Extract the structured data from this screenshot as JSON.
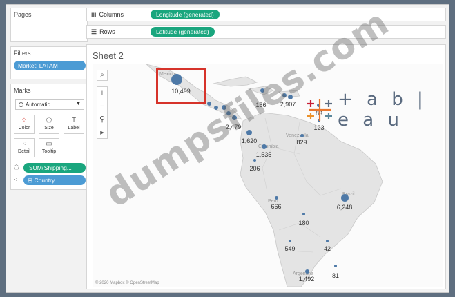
{
  "pages": {
    "title": "Pages"
  },
  "filters": {
    "title": "Filters",
    "pill": "Market: LATAM"
  },
  "marks": {
    "title": "Marks",
    "type": "Automatic",
    "buttons": [
      {
        "label": "Color",
        "icon": "color-dots-icon"
      },
      {
        "label": "Size",
        "icon": "size-icon"
      },
      {
        "label": "Label",
        "icon": "label-icon"
      },
      {
        "label": "Detail",
        "icon": "detail-icon"
      },
      {
        "label": "Tooltip",
        "icon": "tooltip-icon"
      }
    ],
    "fields": [
      "SUM(Shipping...",
      "⊞ Country"
    ]
  },
  "columns": {
    "label": "Columns",
    "pill": "Longitude (generated)"
  },
  "rows": {
    "label": "Rows",
    "pill": "Latitude (generated)"
  },
  "sheet": {
    "title": "Sheet 2"
  },
  "map": {
    "credit": "© 2020 Mapbox © OpenStreetMap",
    "place_names": {
      "mexico": "Mexico",
      "venezuela": "Venezuela",
      "colombia": "Colombia",
      "peru": "Peru",
      "brazil": "Brazil",
      "argentina": "Argentina"
    },
    "labels": {
      "mexico": "10,499",
      "guatemala": "2,479",
      "panama": "1,620",
      "cuba": "156",
      "dominican": "2,907",
      "trinidad": "83",
      "guyana": "123",
      "venezuela": "829",
      "colombia": "1,535",
      "ecuador": "206",
      "peru": "666",
      "brazil": "6,248",
      "bolivia": "180",
      "paraguay": "42",
      "chile": "549",
      "argentina": "1,492",
      "uruguay": "81"
    }
  },
  "logo": {
    "word": "+ a b | e a u"
  },
  "watermark": "dumpsfiles.com",
  "colors": {
    "measure_pill": "#1aa67e",
    "dimension_pill": "#4c9bd4",
    "mark": "#4e79a7",
    "highlight": "#d6332a"
  }
}
